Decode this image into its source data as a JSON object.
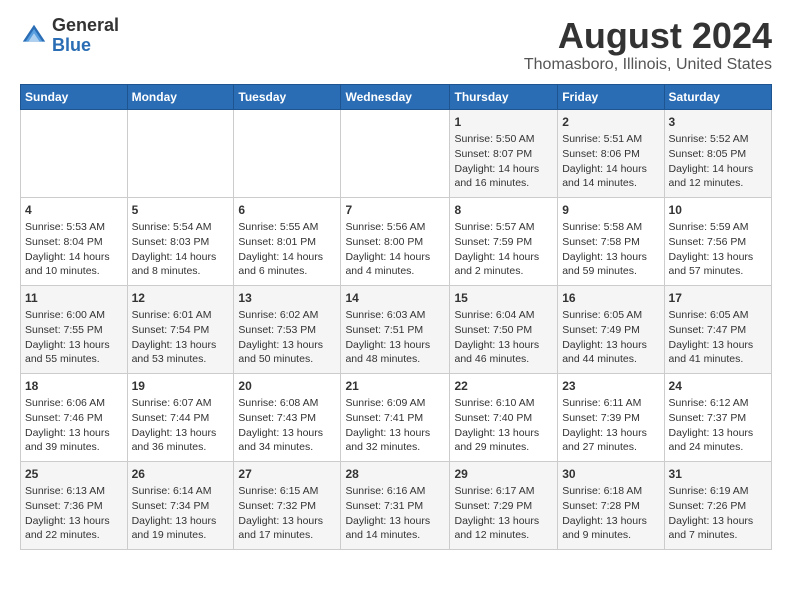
{
  "logo": {
    "general": "General",
    "blue": "Blue"
  },
  "title": "August 2024",
  "subtitle": "Thomasboro, Illinois, United States",
  "weekdays": [
    "Sunday",
    "Monday",
    "Tuesday",
    "Wednesday",
    "Thursday",
    "Friday",
    "Saturday"
  ],
  "weeks": [
    [
      {
        "day": "",
        "info": ""
      },
      {
        "day": "",
        "info": ""
      },
      {
        "day": "",
        "info": ""
      },
      {
        "day": "",
        "info": ""
      },
      {
        "day": "1",
        "info": "Sunrise: 5:50 AM\nSunset: 8:07 PM\nDaylight: 14 hours and 16 minutes."
      },
      {
        "day": "2",
        "info": "Sunrise: 5:51 AM\nSunset: 8:06 PM\nDaylight: 14 hours and 14 minutes."
      },
      {
        "day": "3",
        "info": "Sunrise: 5:52 AM\nSunset: 8:05 PM\nDaylight: 14 hours and 12 minutes."
      }
    ],
    [
      {
        "day": "4",
        "info": "Sunrise: 5:53 AM\nSunset: 8:04 PM\nDaylight: 14 hours and 10 minutes."
      },
      {
        "day": "5",
        "info": "Sunrise: 5:54 AM\nSunset: 8:03 PM\nDaylight: 14 hours and 8 minutes."
      },
      {
        "day": "6",
        "info": "Sunrise: 5:55 AM\nSunset: 8:01 PM\nDaylight: 14 hours and 6 minutes."
      },
      {
        "day": "7",
        "info": "Sunrise: 5:56 AM\nSunset: 8:00 PM\nDaylight: 14 hours and 4 minutes."
      },
      {
        "day": "8",
        "info": "Sunrise: 5:57 AM\nSunset: 7:59 PM\nDaylight: 14 hours and 2 minutes."
      },
      {
        "day": "9",
        "info": "Sunrise: 5:58 AM\nSunset: 7:58 PM\nDaylight: 13 hours and 59 minutes."
      },
      {
        "day": "10",
        "info": "Sunrise: 5:59 AM\nSunset: 7:56 PM\nDaylight: 13 hours and 57 minutes."
      }
    ],
    [
      {
        "day": "11",
        "info": "Sunrise: 6:00 AM\nSunset: 7:55 PM\nDaylight: 13 hours and 55 minutes."
      },
      {
        "day": "12",
        "info": "Sunrise: 6:01 AM\nSunset: 7:54 PM\nDaylight: 13 hours and 53 minutes."
      },
      {
        "day": "13",
        "info": "Sunrise: 6:02 AM\nSunset: 7:53 PM\nDaylight: 13 hours and 50 minutes."
      },
      {
        "day": "14",
        "info": "Sunrise: 6:03 AM\nSunset: 7:51 PM\nDaylight: 13 hours and 48 minutes."
      },
      {
        "day": "15",
        "info": "Sunrise: 6:04 AM\nSunset: 7:50 PM\nDaylight: 13 hours and 46 minutes."
      },
      {
        "day": "16",
        "info": "Sunrise: 6:05 AM\nSunset: 7:49 PM\nDaylight: 13 hours and 44 minutes."
      },
      {
        "day": "17",
        "info": "Sunrise: 6:05 AM\nSunset: 7:47 PM\nDaylight: 13 hours and 41 minutes."
      }
    ],
    [
      {
        "day": "18",
        "info": "Sunrise: 6:06 AM\nSunset: 7:46 PM\nDaylight: 13 hours and 39 minutes."
      },
      {
        "day": "19",
        "info": "Sunrise: 6:07 AM\nSunset: 7:44 PM\nDaylight: 13 hours and 36 minutes."
      },
      {
        "day": "20",
        "info": "Sunrise: 6:08 AM\nSunset: 7:43 PM\nDaylight: 13 hours and 34 minutes."
      },
      {
        "day": "21",
        "info": "Sunrise: 6:09 AM\nSunset: 7:41 PM\nDaylight: 13 hours and 32 minutes."
      },
      {
        "day": "22",
        "info": "Sunrise: 6:10 AM\nSunset: 7:40 PM\nDaylight: 13 hours and 29 minutes."
      },
      {
        "day": "23",
        "info": "Sunrise: 6:11 AM\nSunset: 7:39 PM\nDaylight: 13 hours and 27 minutes."
      },
      {
        "day": "24",
        "info": "Sunrise: 6:12 AM\nSunset: 7:37 PM\nDaylight: 13 hours and 24 minutes."
      }
    ],
    [
      {
        "day": "25",
        "info": "Sunrise: 6:13 AM\nSunset: 7:36 PM\nDaylight: 13 hours and 22 minutes."
      },
      {
        "day": "26",
        "info": "Sunrise: 6:14 AM\nSunset: 7:34 PM\nDaylight: 13 hours and 19 minutes."
      },
      {
        "day": "27",
        "info": "Sunrise: 6:15 AM\nSunset: 7:32 PM\nDaylight: 13 hours and 17 minutes."
      },
      {
        "day": "28",
        "info": "Sunrise: 6:16 AM\nSunset: 7:31 PM\nDaylight: 13 hours and 14 minutes."
      },
      {
        "day": "29",
        "info": "Sunrise: 6:17 AM\nSunset: 7:29 PM\nDaylight: 13 hours and 12 minutes."
      },
      {
        "day": "30",
        "info": "Sunrise: 6:18 AM\nSunset: 7:28 PM\nDaylight: 13 hours and 9 minutes."
      },
      {
        "day": "31",
        "info": "Sunrise: 6:19 AM\nSunset: 7:26 PM\nDaylight: 13 hours and 7 minutes."
      }
    ]
  ]
}
